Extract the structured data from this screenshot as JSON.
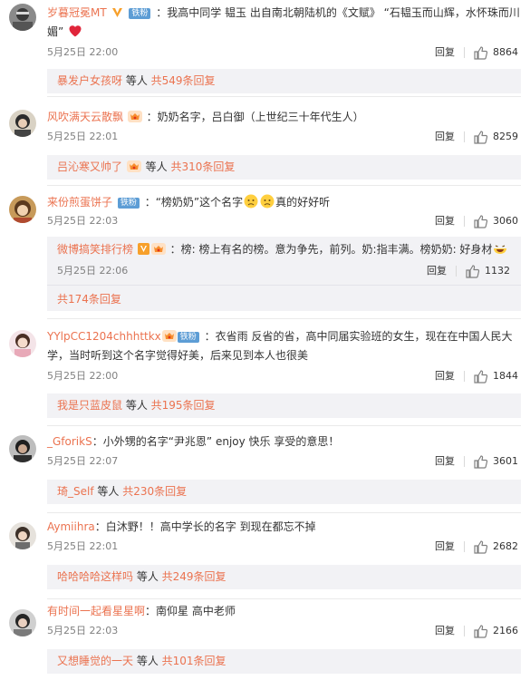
{
  "colors": {
    "username": "#eb7350",
    "fan_badge": "#5d9dd5",
    "reply_bg": "#f2f2f5",
    "time": "#808080"
  },
  "ui": {
    "reply_label": "回复",
    "like_icon": "thumbs-up-icon"
  },
  "comments": [
    {
      "user": "岁暮冠冕MT",
      "badges": [
        "verified-v-icon",
        "铁粉"
      ],
      "text": "：我高中同学  韫玉   出自南北朝陆机的《文赋》 “石韫玉而山辉，水怀珠而川媚”",
      "emoji": "red-heart-icon",
      "time": "5月25日 22:00",
      "likes": "8864",
      "reply_user": "暴发户女孩呀",
      "reply_mid": " 等人 ",
      "reply_total": "共549条回复"
    },
    {
      "user": "风吹满天云散飘",
      "badges": [
        "vip-crown-icon"
      ],
      "text": "：奶奶名字，吕白御（上世纪三十年代生人）",
      "time": "5月25日 22:01",
      "likes": "8259",
      "reply_user": "吕沁寒又帅了",
      "reply_mid": " 等人 ",
      "reply_total": "共310条回复"
    },
    {
      "user": "来份煎蛋饼子",
      "badges": [
        "铁粉"
      ],
      "text_pre": "：“榜奶奶”这个名字",
      "text_post": "真的好好听",
      "emojis": [
        "sad-face-icon",
        "sad-face-icon"
      ],
      "time": "5月25日 22:03",
      "likes": "3060",
      "sub": {
        "user": "微博搞笑排行榜",
        "badges": [
          "orange-v-icon",
          "vip-crown-icon"
        ],
        "text": "：榜: 榜上有名的榜。意为争先，前列。奶:指丰满。榜奶奶: 好身材",
        "emoji": "laughing-icon",
        "time": "5月25日 22:06",
        "likes": "1132"
      },
      "reply_total": "共174条回复"
    },
    {
      "user": "YYlpCC1204chhhttkx",
      "badges": [
        "vip-crown-icon",
        "铁粉"
      ],
      "text": "：衣省雨  反省的省，高中同届实验班的女生，现在在中国人民大学，当时听到这个名字觉得好美，后来见到本人也很美",
      "time": "5月25日 22:00",
      "likes": "1844",
      "reply_user": "我是只蓝皮鼠",
      "reply_mid": " 等人 ",
      "reply_total": "共195条回复"
    },
    {
      "user": "_GforikS",
      "badges": [],
      "text": "：小外甥的名字“尹兆恩”  enjoy  快乐  享受的意思！",
      "time": "5月25日 22:07",
      "likes": "3601",
      "reply_user": "琦_Self",
      "reply_mid": " 等人 ",
      "reply_total": "共230条回复"
    },
    {
      "user": "Aymiihra",
      "badges": [],
      "text": "：白沐野！！高中学长的名字 到现在都忘不掉",
      "time": "5月25日 22:01",
      "likes": "2682",
      "reply_user": "哈哈哈哈这样吗",
      "reply_mid": " 等人 ",
      "reply_total": "共249条回复"
    },
    {
      "user": "有时间一起看星星啊",
      "badges": [],
      "text": "：南仰星  高中老师",
      "time": "5月25日 22:03",
      "likes": "2166",
      "reply_user": "又想睡觉的一天",
      "reply_mid": " 等人 ",
      "reply_total": "共101条回复"
    }
  ]
}
